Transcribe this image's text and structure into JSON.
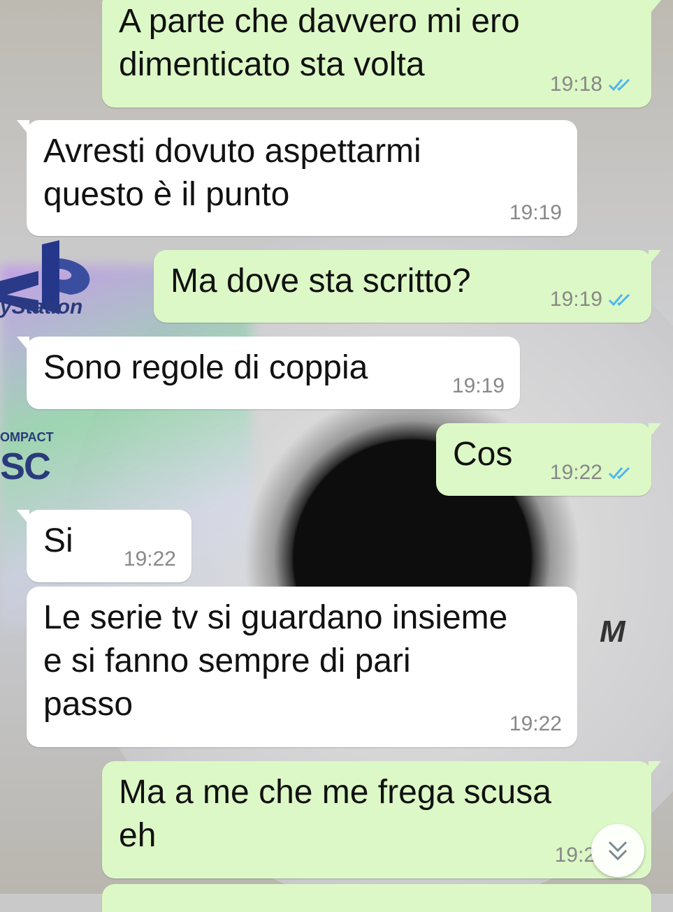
{
  "colors": {
    "incoming_bubble": "#ffffff",
    "outgoing_bubble": "#dcf8c6",
    "read_ticks": "#4fb6ec",
    "timestamp": "#888888"
  },
  "wallpaper": {
    "console_text": "yStation",
    "disc_text": "OMPACT",
    "disc_logo": "SC",
    "side_letter": "M"
  },
  "messages": [
    {
      "direction": "out",
      "text": "A parte che davvero mi ero\ndimenticato sta volta",
      "time": "19:18",
      "status_icon": "double-check-read-icon"
    },
    {
      "direction": "in",
      "text": "Avresti dovuto aspettarmi\nquesto è il punto",
      "time": "19:19"
    },
    {
      "direction": "out",
      "text": "Ma dove sta scritto?",
      "time": "19:19",
      "status_icon": "double-check-read-icon"
    },
    {
      "direction": "in",
      "text": "Sono regole di coppia",
      "time": "19:19"
    },
    {
      "direction": "out",
      "text": "Cos",
      "time": "19:22",
      "status_icon": "double-check-read-icon"
    },
    {
      "direction": "in",
      "text": "Si",
      "time": "19:22"
    },
    {
      "direction": "in",
      "text": "Le serie tv si guardano insieme\ne si fanno sempre di pari\npasso",
      "time": "19:22"
    },
    {
      "direction": "out",
      "text": "Ma a me che me frega scusa\neh",
      "time": "19:2",
      "status_icon": "double-check-read-icon"
    }
  ],
  "scroll_down_icon": "double-chevron-down-icon"
}
